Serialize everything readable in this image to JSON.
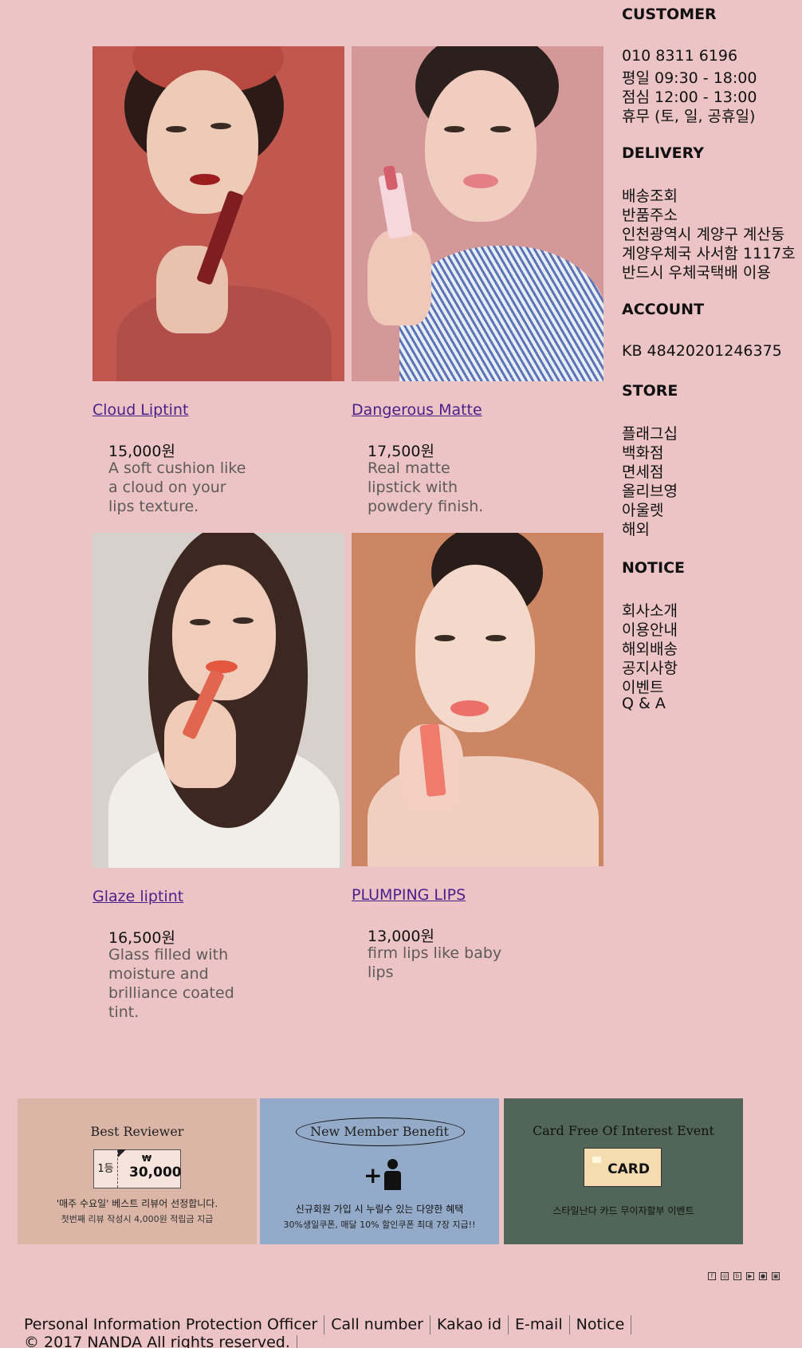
{
  "products": [
    {
      "name": "Cloud Liptint",
      "price": "15,000원",
      "description": "A soft cushion like a cloud on your lips texture.",
      "photo_icon": "model-with-red-lipstick-image"
    },
    {
      "name": "Dangerous Matte",
      "price": "17,500원",
      "description": "Real matte lipstick with powdery finish.",
      "photo_icon": "model-with-pink-lipstick-image"
    },
    {
      "name": "Glaze liptint",
      "price": "16,500원",
      "description": "Glass filled with moisture and brilliance coated tint.",
      "photo_icon": "model-with-coral-tint-image"
    },
    {
      "name": "PLUMPING LIPS",
      "price": "13,000원",
      "description": "firm lips like baby lips",
      "photo_icon": "model-with-coral-lips-image"
    }
  ],
  "sidebar": {
    "customer": {
      "heading": "CUSTOMER",
      "lines": [
        "010 8311 6196",
        "평일 09:30 - 18:00",
        "점심 12:00 - 13:00",
        "휴무 (토, 일, 공휴일)"
      ]
    },
    "delivery": {
      "heading": "DELIVERY",
      "lines": [
        "배송조회",
        "반품주소",
        "인천광역시 계양구 계산동",
        "계양우체국 사서함 1117호",
        "반드시 우체국택배 이용"
      ]
    },
    "account": {
      "heading": "ACCOUNT",
      "lines": [
        "KB 48420201246375"
      ]
    },
    "store": {
      "heading": "STORE",
      "lines": [
        "플래그십",
        "백화점",
        "면세점",
        "올리브영",
        "아울렛",
        "해외"
      ]
    },
    "notice": {
      "heading": "NOTICE",
      "lines": [
        "회사소개",
        "이용안내",
        "해외배송",
        "공지사항",
        "이벤트",
        "Q & A"
      ]
    }
  },
  "banners": {
    "reviewer": {
      "title": "Best Reviewer",
      "rank": "1등",
      "currency": "₩",
      "amount": "30,000",
      "line1": "'매주 수요일' 베스트 리뷰어 선정합니다.",
      "line2": "첫번째 리뷰 작성시 4,000원 적립금 지급"
    },
    "member": {
      "title": "New Member Benefit",
      "line1": "신규회원 가입 시 누릴수 있는 다양한 혜택",
      "line2": "30%생일쿠폰, 매달 10% 할인쿠폰 최대 7장 지급!!"
    },
    "card": {
      "title": "Card Free Of Interest Event",
      "card_label": "CARD",
      "line1": "스타일난다 카드 무이자할부 이벤트"
    }
  },
  "social_icons": [
    "facebook-icon",
    "instagram-icon",
    "blog-icon",
    "youtube-icon",
    "kakao-icon",
    "store-icon"
  ],
  "footer": {
    "links": [
      "Personal Information Protection Officer",
      "Call number",
      "Kakao id",
      "E-mail",
      "Notice"
    ],
    "copyright": "© 2017 NANDA All rights reserved."
  },
  "colors": {
    "background": "#ecc4c5",
    "link": "#4b1f8a",
    "reviewer_banner": "#dbb6a7",
    "member_banner": "#93aac8",
    "card_banner": "#516558"
  }
}
